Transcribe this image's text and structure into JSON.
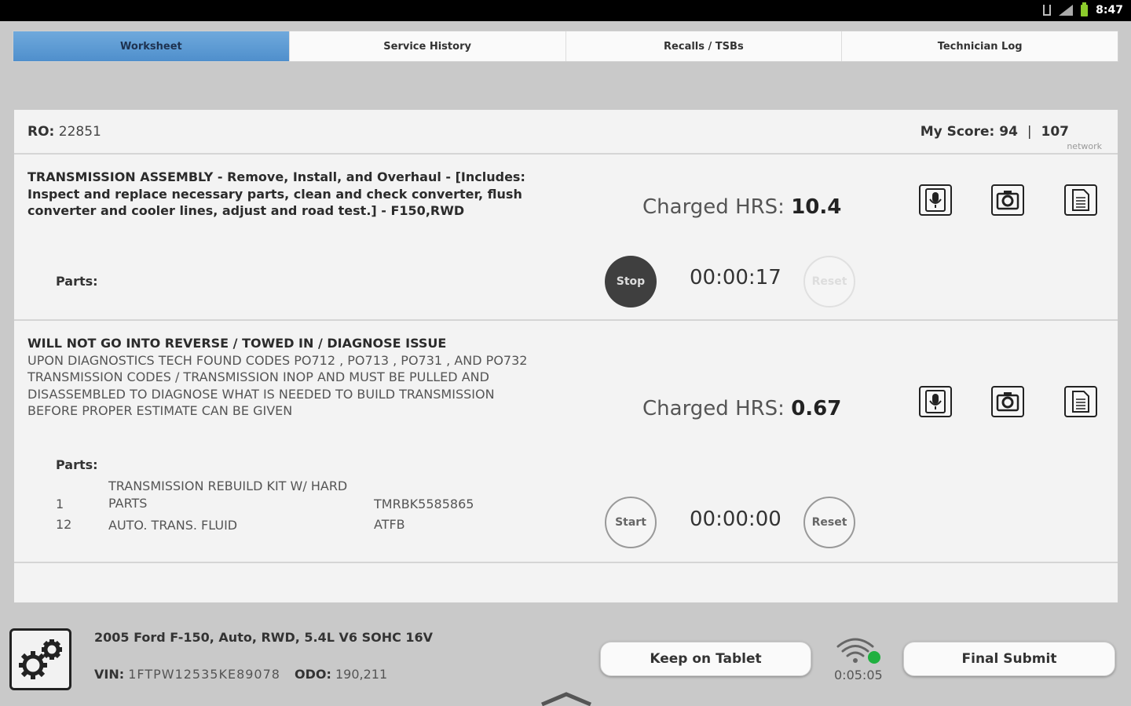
{
  "status_bar": {
    "time": "8:47",
    "icons": [
      "usb-icon",
      "signal-icon",
      "battery-icon"
    ]
  },
  "tabs": [
    {
      "label": "Worksheet",
      "active": true
    },
    {
      "label": "Service History",
      "active": false
    },
    {
      "label": "Recalls / TSBs",
      "active": false
    },
    {
      "label": "Technician Log",
      "active": false
    }
  ],
  "header": {
    "ro_label": "RO:",
    "ro_value": "22851",
    "score_label": "My Score:",
    "score_value": "94",
    "score_network_value": "107",
    "network_label": "network"
  },
  "jobs": [
    {
      "description": "TRANSMISSION ASSEMBLY - Remove, Install, and Overhaul - [Includes: Inspect and replace necessary parts, clean and check converter, flush converter and cooler lines, adjust and road test.] - F150,RWD",
      "charged_label": "Charged HRS:",
      "charged_value": "10.4",
      "parts_label": "Parts:",
      "timer": "00:00:17",
      "primary_button": "Stop",
      "reset_button": "Reset"
    },
    {
      "title": "WILL NOT GO INTO REVERSE / TOWED IN / DIAGNOSE ISSUE",
      "detail": "UPON DIAGNOSTICS TECH FOUND CODES PO712 , PO713 , PO731 , AND PO732 TRANSMISSION CODES / TRANSMISSION INOP AND MUST BE PULLED AND DISASSEMBLED TO DIAGNOSE WHAT IS NEEDED TO BUILD TRANSMISSION BEFORE PROPER ESTIMATE CAN BE GIVEN",
      "charged_label": "Charged HRS:",
      "charged_value": "0.67",
      "parts_label": "Parts:",
      "parts": [
        {
          "qty": "1",
          "name": "TRANSMISSION REBUILD KIT W/ HARD PARTS",
          "number": "TMRBK5585865"
        },
        {
          "qty": "12",
          "name": "AUTO. TRANS. FLUID",
          "number": "ATFB"
        }
      ],
      "timer": "00:00:00",
      "primary_button": "Start",
      "reset_button": "Reset"
    }
  ],
  "footer": {
    "vehicle": "2005 Ford F-150, Auto, RWD, 5.4L V6 SOHC 16V",
    "vin_label": "VIN:",
    "vin_value": "1FTPW12535KE89078",
    "odo_label": "ODO:",
    "odo_value": "190,211",
    "keep_button": "Keep on Tablet",
    "submit_button": "Final Submit",
    "sync_time": "0:05:05"
  }
}
